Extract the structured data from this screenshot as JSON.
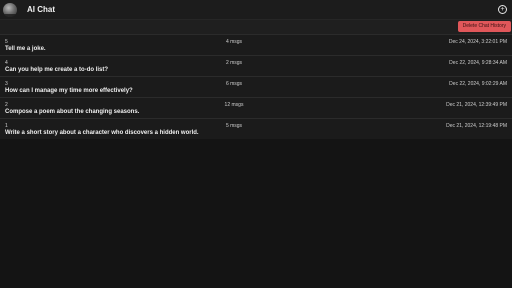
{
  "header": {
    "title": "AI Chat",
    "add_icon": "plus-circle-icon"
  },
  "toolbar": {
    "delete_label": "Delete Chat History",
    "delete_color": "#e0575a"
  },
  "chats": [
    {
      "id": "5",
      "messages": "4 msgs",
      "date": "Dec 24, 2024, 3:22:01 PM",
      "prompt": "Tell me a joke."
    },
    {
      "id": "4",
      "messages": "2 msgs",
      "date": "Dec 22, 2024, 9:28:34 AM",
      "prompt": "Can you help me create a to-do list?"
    },
    {
      "id": "3",
      "messages": "6 msgs",
      "date": "Dec 22, 2024, 9:02:29 AM",
      "prompt": "How can I manage my time more effectively?"
    },
    {
      "id": "2",
      "messages": "12 msgs",
      "date": "Dec 21, 2024, 12:39:49 PM",
      "prompt": "Compose a poem about the changing seasons."
    },
    {
      "id": "1",
      "messages": "5 msgs",
      "date": "Dec 21, 2024, 12:19:48 PM",
      "prompt": "Write a short story about a character who discovers a hidden world."
    }
  ]
}
